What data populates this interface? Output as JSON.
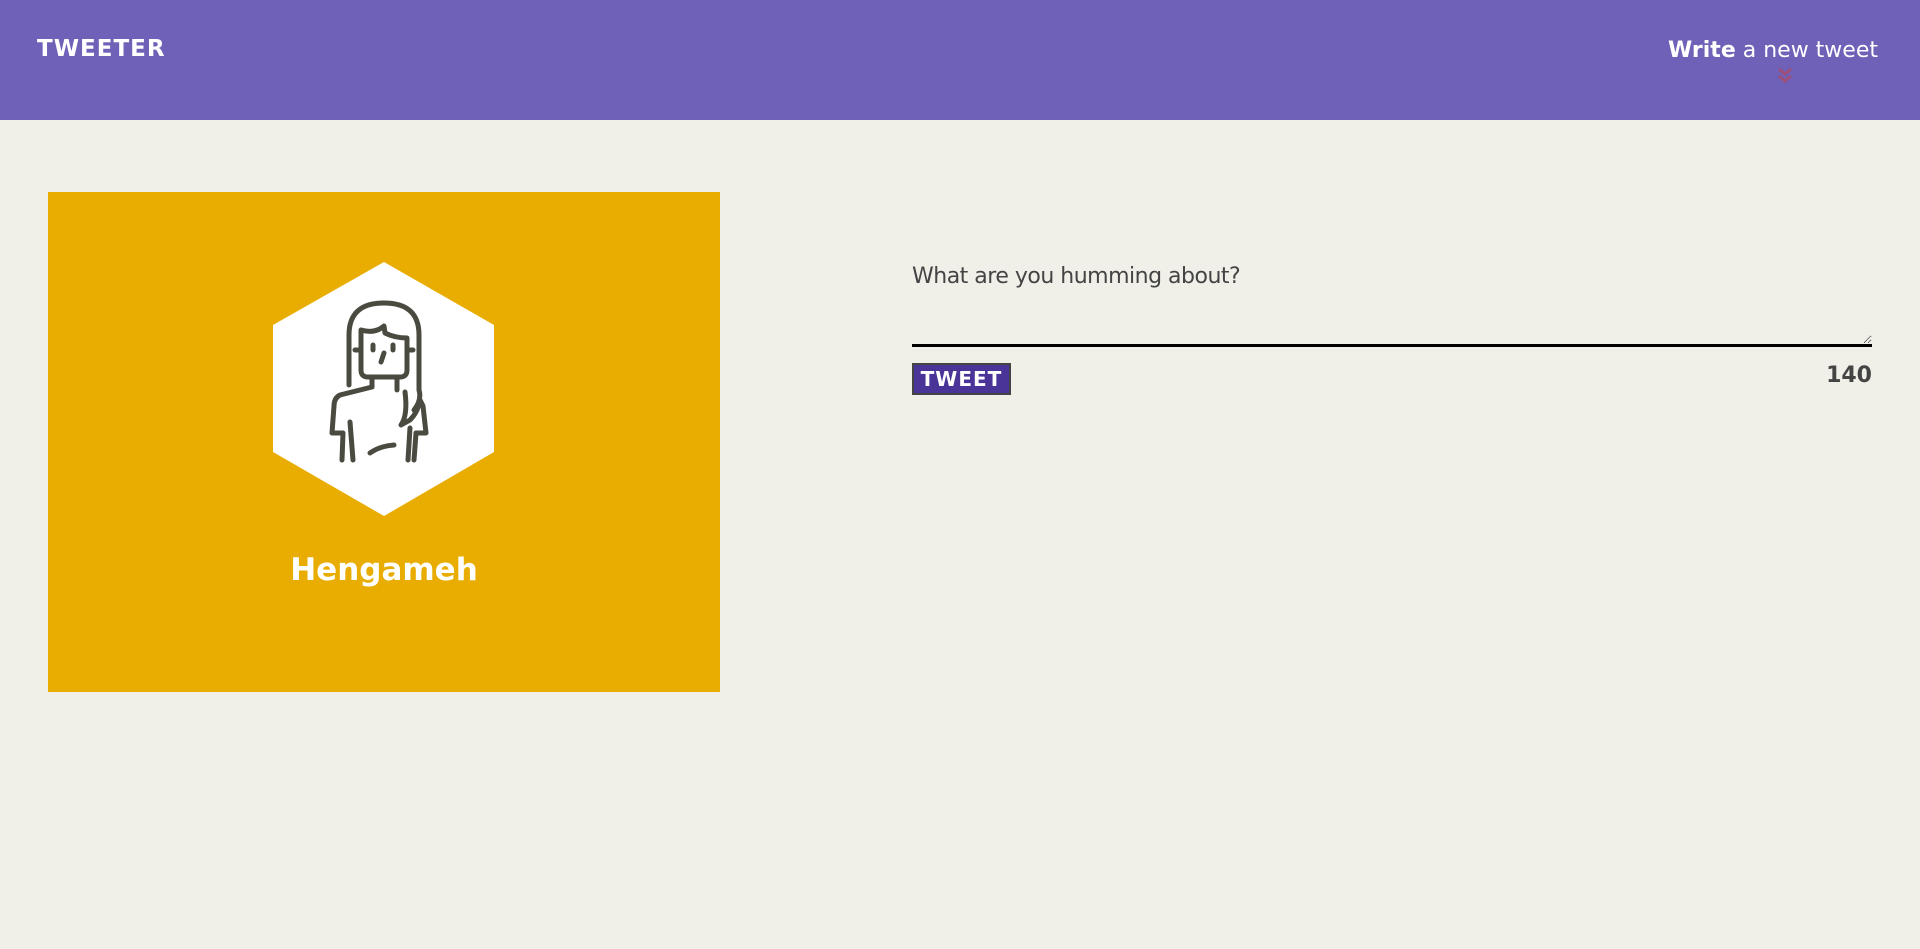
{
  "header": {
    "logo": "TWEETER",
    "write_bold": "Write",
    "write_rest": " a new tweet",
    "chevron_icon": "double-chevron-down-icon",
    "background": "#6e61b7"
  },
  "profile": {
    "name": "Hengameh",
    "avatar_icon": "woman-avatar-icon",
    "background": "#e8ad00"
  },
  "composer": {
    "label": "What are you humming about?",
    "value": "",
    "button_label": "TWEET",
    "counter": "140",
    "button_color": "#4a3498"
  }
}
